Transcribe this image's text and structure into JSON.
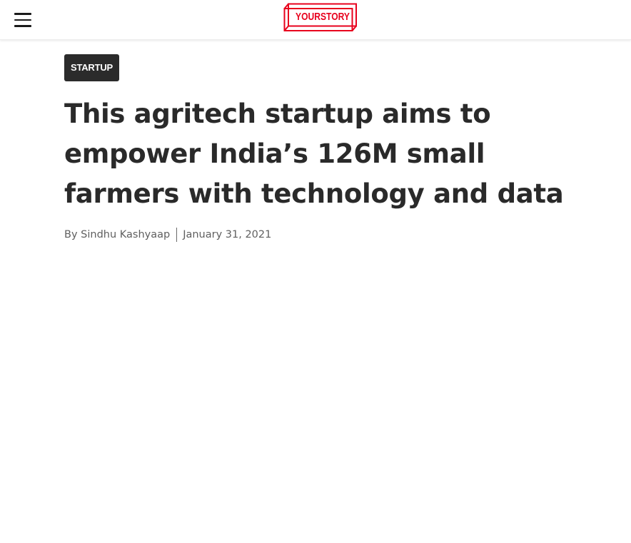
{
  "header": {
    "menu_icon": "hamburger-menu-icon",
    "logo": {
      "text": "YOURSTORY",
      "color": "#e8001c"
    }
  },
  "article": {
    "category": "STARTUP",
    "title": "This agritech startup aims to empower India’s 126M small farmers with technology and data",
    "byline_prefix": "By",
    "author": "Sindhu Kashyaap",
    "date": "January 31, 2021"
  }
}
